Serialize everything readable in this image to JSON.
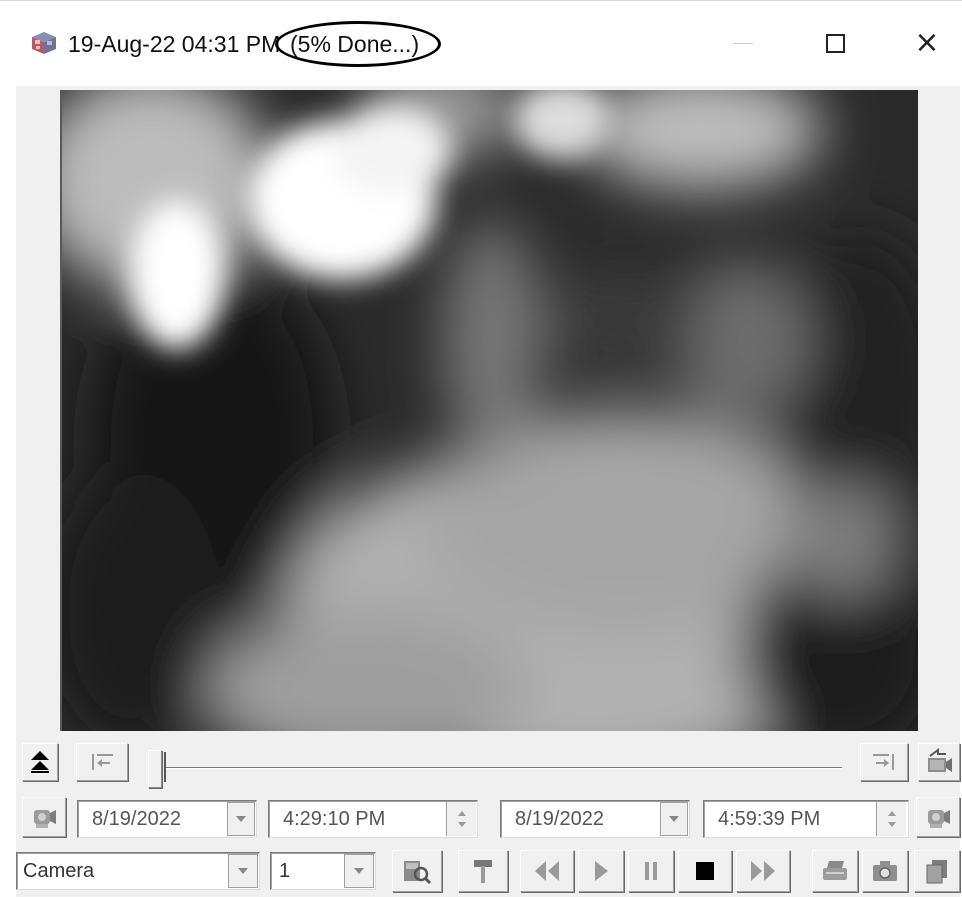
{
  "window": {
    "title": "19-Aug-22 04:31 PM",
    "status": "(5% Done...)",
    "icons": {
      "app": "camera-cube-icon",
      "minimize": "minimize-icon",
      "maximize": "maximize-icon",
      "close": "close-icon"
    },
    "close_glyph": "×"
  },
  "playback": {
    "progress_percent": 5,
    "start_date": "8/19/2022",
    "start_time": "4:29:10 PM",
    "end_date": "8/19/2022",
    "end_time": "4:59:39 PM",
    "camera_select": "Camera",
    "channel_select": "1"
  },
  "colors": {
    "window_bg": "#ffffff",
    "panel_bg": "#f0f0f0",
    "video_bg": "#282828",
    "accent_dark": "#000000"
  }
}
